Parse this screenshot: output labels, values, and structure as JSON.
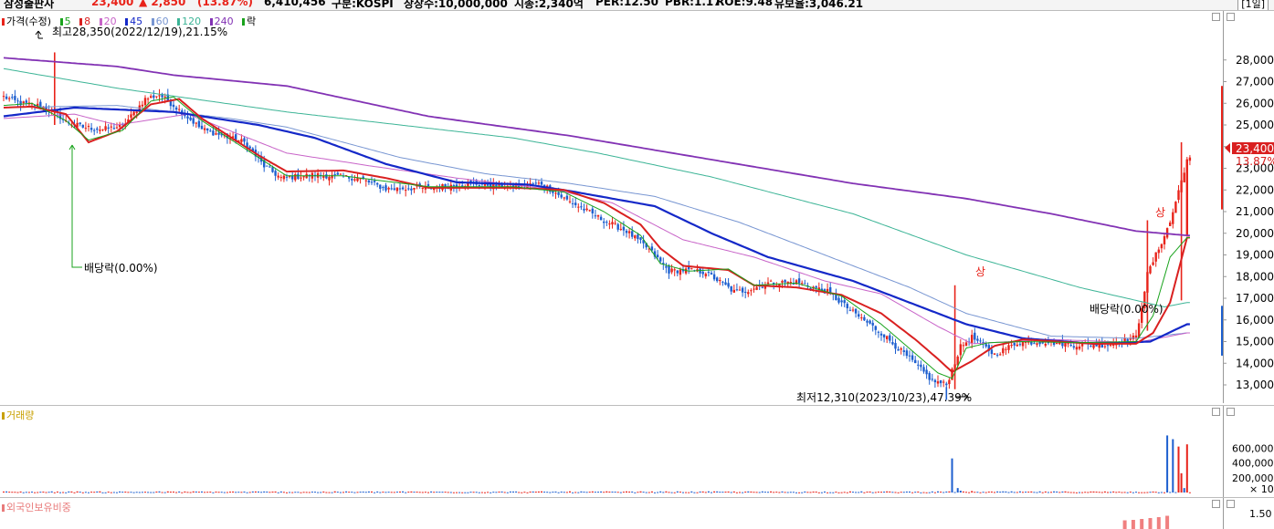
{
  "header": {
    "stock_name": "삼성출판사",
    "price": "23,400",
    "change": "▲ 2,850",
    "change_pct": "(13.87%)",
    "volume": "6,410,456",
    "market": "구분:KOSPI",
    "shares": "상장수:10,000,000",
    "market_cap": "시총:2,340억",
    "per": "PER:12.50",
    "pbr": "PBR:1.17",
    "roe": "ROE:9.48",
    "float": "유보율:3,046.21",
    "period_button": "[1일]"
  },
  "price_pane": {
    "legend": {
      "title": "가격(수정)",
      "ma5": "5",
      "ma8": "8",
      "ma20": "20",
      "ma45": "45",
      "ma60": "60",
      "ma120": "120",
      "ma240": "240",
      "ex_rights": "락"
    },
    "current_price_tag": "23,400",
    "current_pct_tag": "13.87%",
    "annotations": {
      "high": "최고28,350(2022/12/19),21.15%",
      "low": "최저12,310(2023/10/23),47.39%",
      "dividend_left": "배당락(0.00%)",
      "dividend_right": "배당락(0.00%)",
      "limit_up_mark": "상"
    }
  },
  "volume_pane": {
    "legend": "거래량",
    "multiplier": "× 10"
  },
  "foreign_pane": {
    "legend": "외국인보유비중",
    "tick": "1.50"
  },
  "colors": {
    "up": "#e8231a",
    "down": "#1d5fcf",
    "ma5": "#19a31c",
    "ma8": "#d92020",
    "ma20": "#c864c8",
    "ma45": "#1428c8",
    "ma60": "#7896d2",
    "ma120": "#3cb496",
    "ma240": "#8232b4"
  },
  "chart_data": [
    {
      "type": "candlestick",
      "title": "가격(수정)",
      "y_ticks": [
        "13,000",
        "14,000",
        "15,000",
        "16,000",
        "17,000",
        "18,000",
        "19,000",
        "20,000",
        "21,000",
        "22,000",
        "23,000",
        "24,000",
        "25,000",
        "26,000",
        "27,000",
        "28,000"
      ],
      "ylim": [
        12000,
        28500
      ],
      "annotations": {
        "high": 28350,
        "low": 12310,
        "last_close": 23400
      },
      "anchors": {
        "close": [
          [
            0,
            26300
          ],
          [
            6,
            26000
          ],
          [
            12,
            25900
          ],
          [
            18,
            25600
          ],
          [
            22,
            25150
          ],
          [
            28,
            24900
          ],
          [
            35,
            24800
          ],
          [
            42,
            24950
          ],
          [
            45,
            25400
          ],
          [
            50,
            26200
          ],
          [
            55,
            26400
          ],
          [
            61,
            25800
          ],
          [
            70,
            24800
          ],
          [
            85,
            24200
          ],
          [
            92,
            23100
          ],
          [
            98,
            22550
          ],
          [
            110,
            22700
          ],
          [
            125,
            22550
          ],
          [
            135,
            22050
          ],
          [
            150,
            22100
          ],
          [
            165,
            22300
          ],
          [
            180,
            22150
          ],
          [
            190,
            22300
          ],
          [
            198,
            21600
          ],
          [
            212,
            20600
          ],
          [
            220,
            20100
          ],
          [
            228,
            19250
          ],
          [
            235,
            18250
          ],
          [
            240,
            18300
          ],
          [
            248,
            18200
          ],
          [
            258,
            17300
          ],
          [
            262,
            17350
          ],
          [
            270,
            17700
          ],
          [
            280,
            17750
          ],
          [
            291,
            17300
          ],
          [
            300,
            16350
          ],
          [
            310,
            15400
          ],
          [
            320,
            14200
          ],
          [
            328,
            13200
          ],
          [
            333,
            13000
          ],
          [
            338,
            14750
          ],
          [
            342,
            15200
          ],
          [
            350,
            14400
          ],
          [
            358,
            14950
          ],
          [
            368,
            15000
          ],
          [
            378,
            14850
          ],
          [
            390,
            14850
          ],
          [
            400,
            15200
          ],
          [
            404,
            18100
          ],
          [
            412,
            20500
          ],
          [
            418,
            23400
          ]
        ],
        "ma5": [
          [
            0,
            25900
          ],
          [
            10,
            26000
          ],
          [
            22,
            25200
          ],
          [
            30,
            24300
          ],
          [
            42,
            24750
          ],
          [
            52,
            26100
          ],
          [
            60,
            26300
          ],
          [
            70,
            25200
          ],
          [
            90,
            23500
          ],
          [
            100,
            22650
          ],
          [
            120,
            22650
          ],
          [
            150,
            22150
          ],
          [
            180,
            22150
          ],
          [
            198,
            21900
          ],
          [
            212,
            21000
          ],
          [
            225,
            19900
          ],
          [
            232,
            18600
          ],
          [
            242,
            18250
          ],
          [
            256,
            18350
          ],
          [
            265,
            17600
          ],
          [
            280,
            17700
          ],
          [
            296,
            17100
          ],
          [
            310,
            15800
          ],
          [
            322,
            14450
          ],
          [
            330,
            13550
          ],
          [
            335,
            13300
          ],
          [
            340,
            14700
          ],
          [
            348,
            14950
          ],
          [
            360,
            15000
          ],
          [
            380,
            14950
          ],
          [
            400,
            15000
          ],
          [
            406,
            16200
          ],
          [
            412,
            18900
          ],
          [
            418,
            19800
          ]
        ],
        "ma8": [
          [
            0,
            25800
          ],
          [
            10,
            25850
          ],
          [
            22,
            25500
          ],
          [
            30,
            24200
          ],
          [
            40,
            24700
          ],
          [
            52,
            25950
          ],
          [
            62,
            26200
          ],
          [
            70,
            25300
          ],
          [
            90,
            23600
          ],
          [
            100,
            22850
          ],
          [
            120,
            22900
          ],
          [
            135,
            22550
          ],
          [
            150,
            22100
          ],
          [
            180,
            22100
          ],
          [
            198,
            22000
          ],
          [
            212,
            21400
          ],
          [
            225,
            20400
          ],
          [
            232,
            19300
          ],
          [
            240,
            18500
          ],
          [
            256,
            18300
          ],
          [
            265,
            17600
          ],
          [
            280,
            17500
          ],
          [
            296,
            17150
          ],
          [
            310,
            16300
          ],
          [
            322,
            15100
          ],
          [
            330,
            14200
          ],
          [
            335,
            13600
          ],
          [
            342,
            14100
          ],
          [
            350,
            14800
          ],
          [
            360,
            15100
          ],
          [
            385,
            14900
          ],
          [
            400,
            14900
          ],
          [
            406,
            15400
          ],
          [
            412,
            16800
          ],
          [
            418,
            19800
          ]
        ],
        "ma20": [
          [
            0,
            25300
          ],
          [
            25,
            25500
          ],
          [
            40,
            25000
          ],
          [
            65,
            25500
          ],
          [
            100,
            23700
          ],
          [
            130,
            23100
          ],
          [
            160,
            22550
          ],
          [
            195,
            22000
          ],
          [
            215,
            21400
          ],
          [
            240,
            19700
          ],
          [
            265,
            18900
          ],
          [
            290,
            17800
          ],
          [
            310,
            17200
          ],
          [
            330,
            15700
          ],
          [
            342,
            14900
          ],
          [
            370,
            15100
          ],
          [
            400,
            14950
          ],
          [
            418,
            15400
          ]
        ],
        "ma45": [
          [
            0,
            25400
          ],
          [
            25,
            25800
          ],
          [
            60,
            25600
          ],
          [
            90,
            25000
          ],
          [
            110,
            24400
          ],
          [
            135,
            23200
          ],
          [
            160,
            22350
          ],
          [
            185,
            22250
          ],
          [
            200,
            21950
          ],
          [
            230,
            21250
          ],
          [
            250,
            20000
          ],
          [
            270,
            18900
          ],
          [
            300,
            17800
          ],
          [
            320,
            16800
          ],
          [
            340,
            15800
          ],
          [
            360,
            15150
          ],
          [
            385,
            14900
          ],
          [
            405,
            15000
          ],
          [
            418,
            15800
          ]
        ],
        "ma60": [
          [
            0,
            25800
          ],
          [
            40,
            25900
          ],
          [
            80,
            25300
          ],
          [
            100,
            24900
          ],
          [
            140,
            23500
          ],
          [
            170,
            22750
          ],
          [
            200,
            22300
          ],
          [
            230,
            21700
          ],
          [
            260,
            20500
          ],
          [
            290,
            19000
          ],
          [
            320,
            17500
          ],
          [
            340,
            16300
          ],
          [
            370,
            15250
          ],
          [
            400,
            15150
          ],
          [
            418,
            15400
          ]
        ],
        "ma120": [
          [
            0,
            27600
          ],
          [
            40,
            26700
          ],
          [
            100,
            25600
          ],
          [
            180,
            24400
          ],
          [
            210,
            23700
          ],
          [
            250,
            22600
          ],
          [
            300,
            20900
          ],
          [
            340,
            19000
          ],
          [
            380,
            17500
          ],
          [
            410,
            16600
          ],
          [
            418,
            16800
          ]
        ],
        "ma240": [
          [
            0,
            28100
          ],
          [
            40,
            27700
          ],
          [
            60,
            27300
          ],
          [
            100,
            26800
          ],
          [
            150,
            25400
          ],
          [
            200,
            24500
          ],
          [
            250,
            23400
          ],
          [
            300,
            22300
          ],
          [
            340,
            21600
          ],
          [
            370,
            20900
          ],
          [
            400,
            20100
          ],
          [
            418,
            19900
          ]
        ]
      }
    },
    {
      "type": "bar",
      "title": "거래량",
      "y_ticks": [
        "200,000",
        "400,000",
        "600,000"
      ],
      "ylim": [
        0,
        800000
      ],
      "spikes": [
        [
          335,
          460000
        ],
        [
          337,
          60000
        ],
        [
          338,
          25000
        ],
        [
          342,
          20000
        ],
        [
          346,
          10000
        ],
        [
          411,
          770000
        ],
        [
          413,
          720000
        ],
        [
          415,
          620000
        ],
        [
          416,
          260000
        ],
        [
          417,
          60000
        ],
        [
          418,
          650000
        ]
      ]
    },
    {
      "type": "bar",
      "title": "외국인보유비중",
      "y_ticks": [
        "1.50"
      ],
      "ylim": [
        1.2,
        1.8
      ],
      "bars": [
        [
          396,
          1.39
        ],
        [
          399,
          1.4
        ],
        [
          402,
          1.42
        ],
        [
          405,
          1.44
        ],
        [
          408,
          1.46
        ],
        [
          411,
          1.49
        ]
      ]
    }
  ]
}
